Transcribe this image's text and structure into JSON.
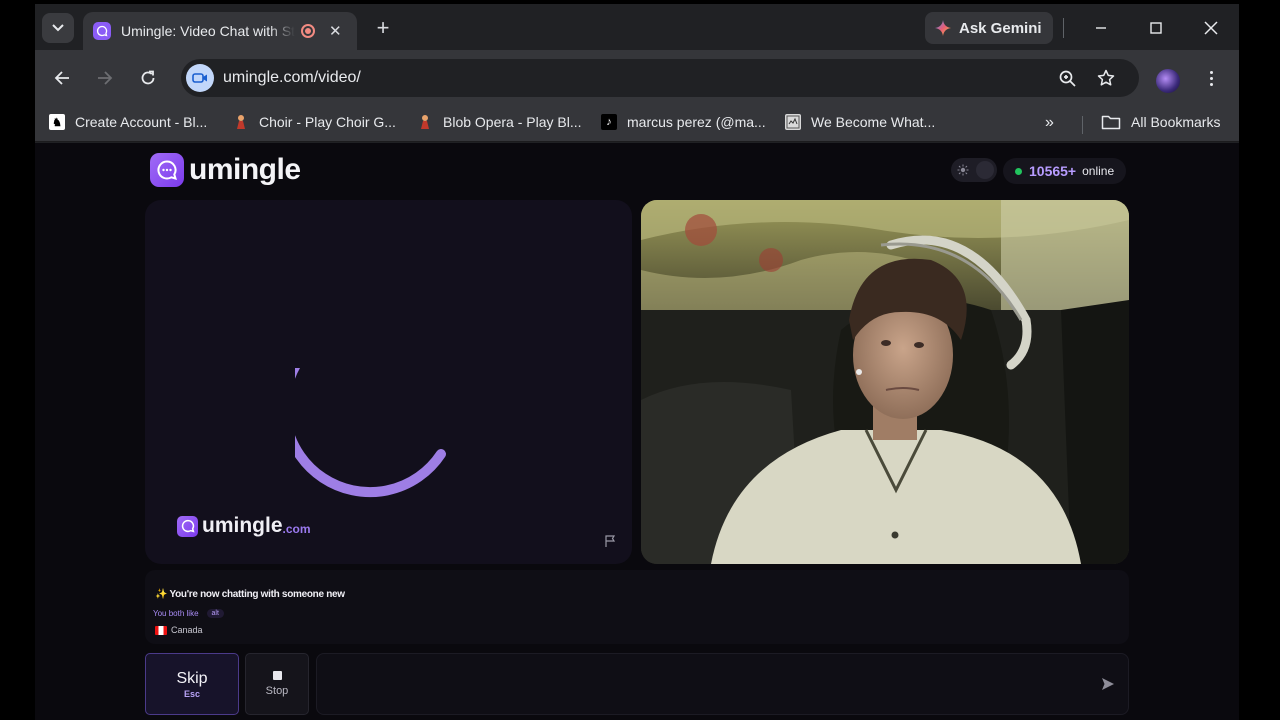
{
  "browser": {
    "tab": {
      "title": "Umingle: Video Chat with Strangers"
    },
    "gemini_label": "Ask Gemini",
    "url": "umingle.com/video/",
    "bookmarks": [
      {
        "label": "Create Account - Bl...",
        "icon": "lichess-icon"
      },
      {
        "label": "Choir - Play Choir G...",
        "icon": "choir-icon"
      },
      {
        "label": "Blob Opera - Play Bl...",
        "icon": "blob-opera-icon"
      },
      {
        "label": "marcus perez (@ma...",
        "icon": "tiktok-icon"
      },
      {
        "label": "We Become What...",
        "icon": "game-icon"
      }
    ],
    "all_bookmarks_label": "All Bookmarks"
  },
  "page": {
    "brand": "umingle",
    "online_count": "10565+",
    "online_label": "online",
    "watermark_brand": "umingle",
    "watermark_suffix": ".com",
    "chat": {
      "status_emoji": "✨",
      "status": "You're now chatting with someone new",
      "common_label": "You both like",
      "common_interest": "alt",
      "country": "Canada"
    },
    "skip_label": "Skip",
    "skip_key": "Esc",
    "stop_label": "Stop",
    "message_placeholder": ""
  },
  "colors": {
    "accent": "#8b5cf6",
    "online_dot": "#22c55e",
    "page_bg": "#0a090e"
  }
}
